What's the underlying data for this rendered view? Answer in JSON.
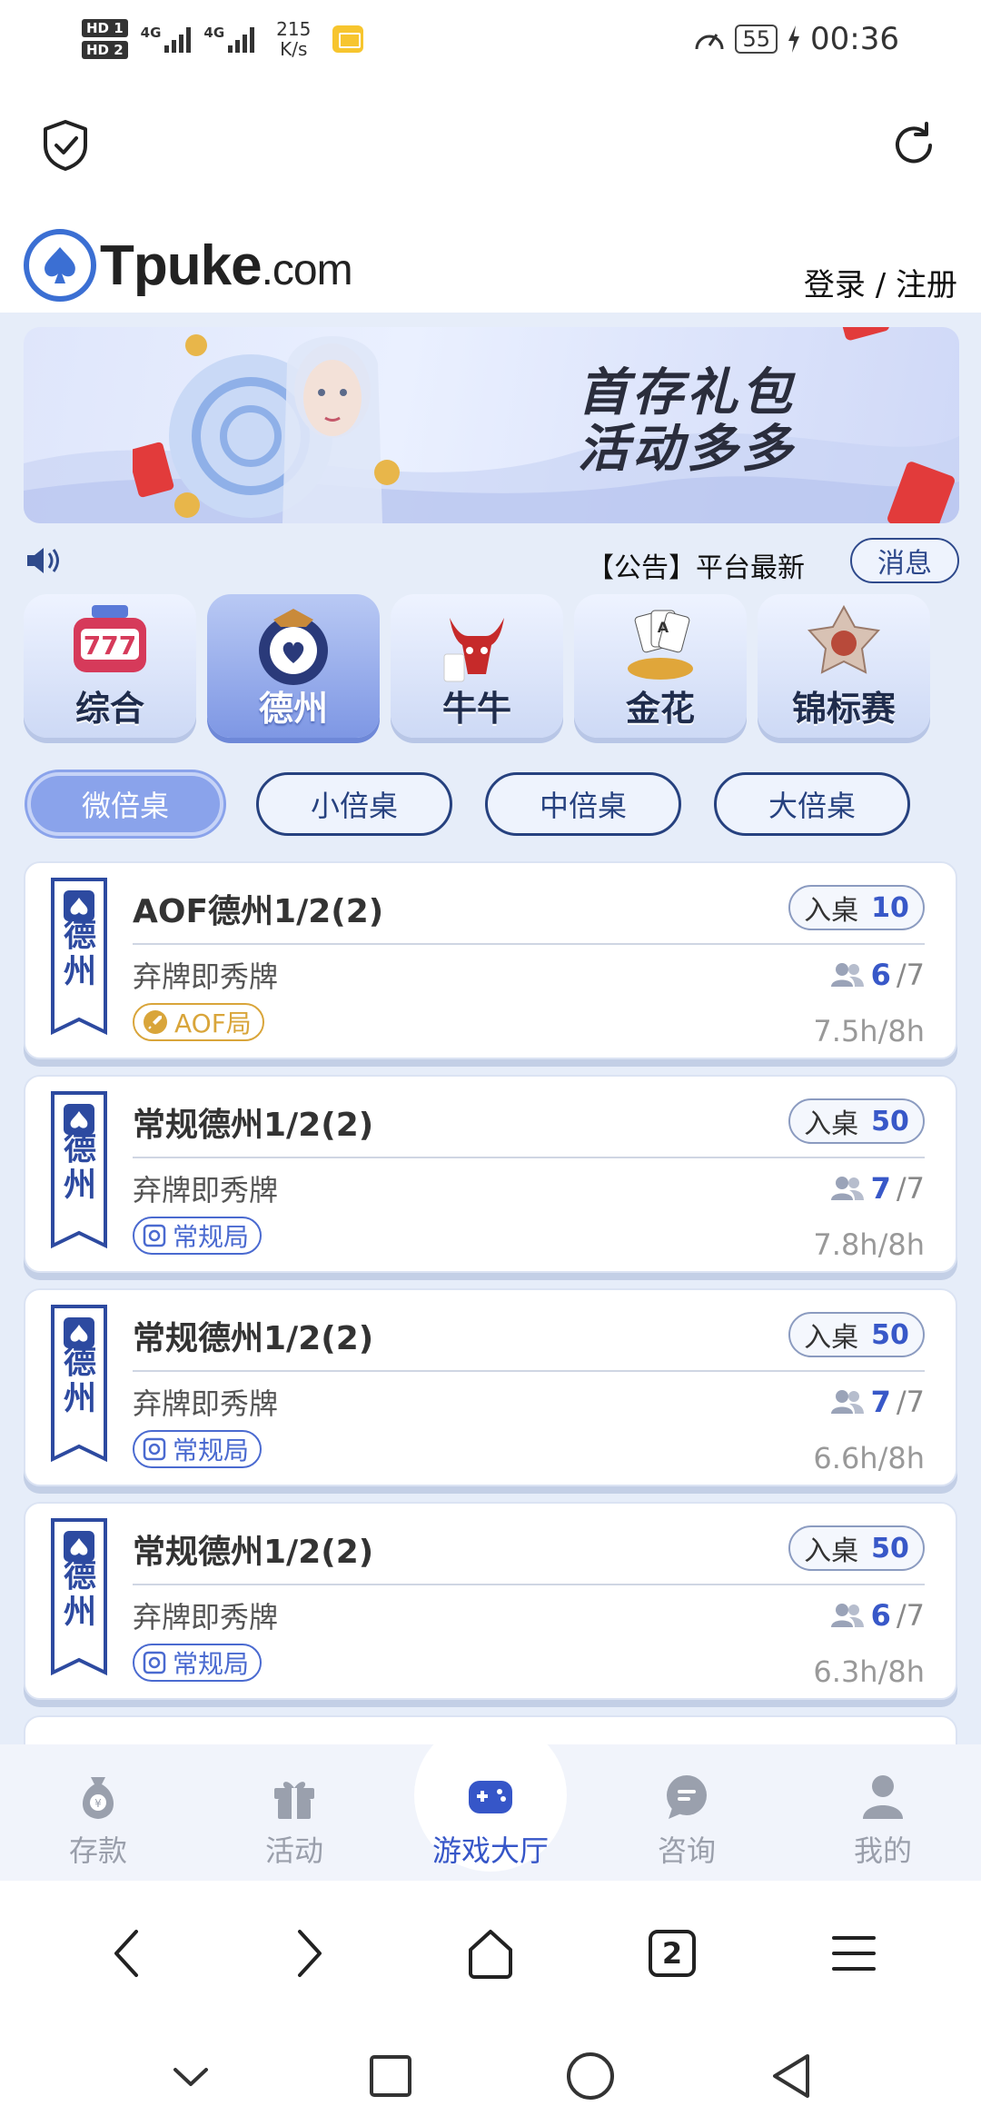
{
  "status_bar": {
    "sim1": "HD 1",
    "sim2": "HD 2",
    "net1": "4G",
    "net2": "4G",
    "speed_value": "215",
    "speed_unit": "K/s",
    "battery": "55",
    "time": "00:36"
  },
  "header": {
    "logo_text_main": "Tpuke",
    "logo_text_suffix": ".com",
    "login_label": "登录 / 注册"
  },
  "banner": {
    "line1": "首存礼包",
    "line2": "活动多多"
  },
  "notice": {
    "text": "【公告】平台最新",
    "message_button": "消息"
  },
  "game_tabs": [
    {
      "label": "综合",
      "icon": "slot-777-icon",
      "active": false
    },
    {
      "label": "德州",
      "icon": "poker-chip-icon",
      "active": true
    },
    {
      "label": "牛牛",
      "icon": "bull-icon",
      "active": false
    },
    {
      "label": "金花",
      "icon": "cards-coins-icon",
      "active": false
    },
    {
      "label": "锦标赛",
      "icon": "trophy-badge-icon",
      "active": false
    }
  ],
  "stake_tabs": [
    {
      "label": "微倍桌",
      "active": true
    },
    {
      "label": "小倍桌",
      "active": false
    },
    {
      "label": "中倍桌",
      "active": false
    },
    {
      "label": "大倍桌",
      "active": false
    }
  ],
  "ribbon_label": "德州",
  "tables": [
    {
      "name": "AOF德州1/2(2)",
      "join_label": "入桌",
      "join_amount": "10",
      "subtitle": "弃牌即秀牌",
      "players_current": "6",
      "players_max": "/7",
      "tag": "AOF局",
      "tag_type": "aof",
      "time": "7.5h/8h"
    },
    {
      "name": "常规德州1/2(2)",
      "join_label": "入桌",
      "join_amount": "50",
      "subtitle": "弃牌即秀牌",
      "players_current": "7",
      "players_max": "/7",
      "tag": "常规局",
      "tag_type": "normal",
      "time": "7.8h/8h"
    },
    {
      "name": "常规德州1/2(2)",
      "join_label": "入桌",
      "join_amount": "50",
      "subtitle": "弃牌即秀牌",
      "players_current": "7",
      "players_max": "/7",
      "tag": "常规局",
      "tag_type": "normal",
      "time": "6.6h/8h"
    },
    {
      "name": "常规德州1/2(2)",
      "join_label": "入桌",
      "join_amount": "50",
      "subtitle": "弃牌即秀牌",
      "players_current": "6",
      "players_max": "/7",
      "tag": "常规局",
      "tag_type": "normal",
      "time": "6.3h/8h"
    }
  ],
  "bottom_nav": [
    {
      "label": "存款",
      "icon": "money-bag-icon",
      "active": false
    },
    {
      "label": "活动",
      "icon": "gift-icon",
      "active": false
    },
    {
      "label": "游戏大厅",
      "icon": "gamepad-icon",
      "active": true
    },
    {
      "label": "咨询",
      "icon": "chat-icon",
      "active": false
    },
    {
      "label": "我的",
      "icon": "user-icon",
      "active": false
    }
  ],
  "browser_nav": {
    "tab_count": "2"
  },
  "colors": {
    "accent": "#3656c8",
    "page_bg": "#e6edf9",
    "aof_tag": "#d9a53a"
  }
}
